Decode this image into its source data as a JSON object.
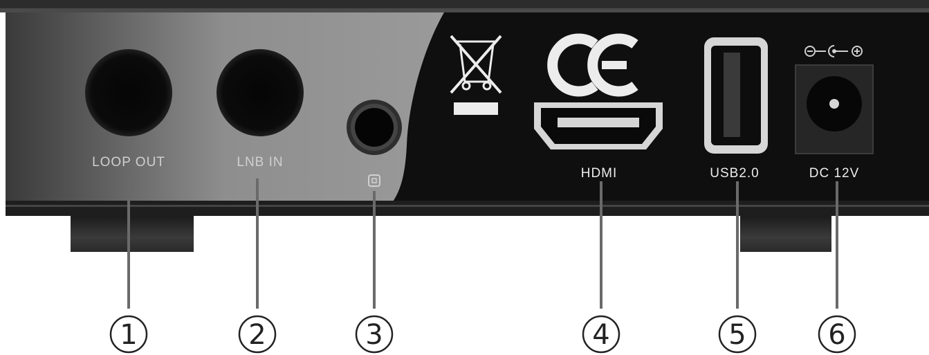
{
  "colors": {
    "panel_dark": "#0f0f0f",
    "panel_gray": "#8c8c8c",
    "label_light": "#d0d0d0",
    "label_white": "#ececec",
    "leader": "#6a6a6a"
  },
  "port_labels": {
    "loop_out": "LOOP  OUT",
    "lnb_in": "LNB IN",
    "hdmi": "HDMI",
    "usb": "USB2.0",
    "dc": "DC 12V"
  },
  "markings": {
    "ce_mark": "CE",
    "weee_icon": "crossed-out-bin-icon",
    "polarity_icon": "dc-polarity-icon",
    "ir_icon": "ir-receiver-icon"
  },
  "callouts": [
    "1",
    "2",
    "3",
    "4",
    "5",
    "6"
  ]
}
